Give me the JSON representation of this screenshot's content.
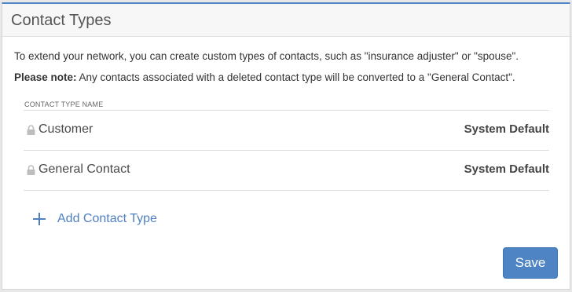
{
  "panel": {
    "title": "Contact Types",
    "intro": "To extend your network, you can create custom types of contacts, such as \"insurance adjuster\" or \"spouse\".",
    "note_label": "Please note:",
    "note_text": " Any contacts associated with a deleted contact type will be converted to a \"General Contact\"."
  },
  "table": {
    "column_header": "CONTACT TYPE NAME",
    "rows": [
      {
        "icon": "lock-icon",
        "name": "Customer",
        "status": "System Default"
      },
      {
        "icon": "lock-icon",
        "name": "General Contact",
        "status": "System Default"
      }
    ]
  },
  "actions": {
    "add_icon": "plus-icon",
    "add_label": "Add Contact Type",
    "save_label": "Save"
  },
  "colors": {
    "accent": "#4f84c4",
    "link": "#4f7fc0",
    "lock_icon": "#bdbdbd"
  }
}
